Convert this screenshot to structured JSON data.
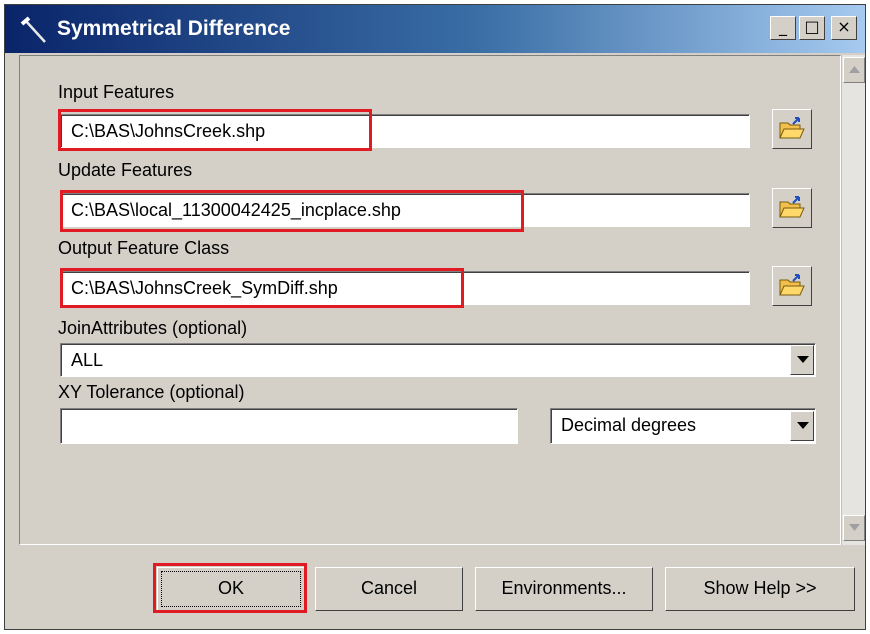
{
  "window": {
    "title": "Symmetrical Difference",
    "minimize_label": "_",
    "maximize_label": "□",
    "close_label": "×"
  },
  "form": {
    "input_features": {
      "label": "Input Features",
      "value": "C:\\BAS\\JohnsCreek.shp"
    },
    "update_features": {
      "label": "Update Features",
      "value": "C:\\BAS\\local_11300042425_incplace.shp"
    },
    "output_feature_class": {
      "label": "Output Feature Class",
      "value": "C:\\BAS\\JohnsCreek_SymDiff.shp"
    },
    "join_attributes": {
      "label": "JoinAttributes (optional)",
      "value": "ALL"
    },
    "xy_tolerance": {
      "label": "XY Tolerance (optional)",
      "value": "",
      "unit": "Decimal degrees"
    }
  },
  "buttons": {
    "ok": "OK",
    "cancel": "Cancel",
    "environments": "Environments...",
    "show_help": "Show Help >>"
  },
  "icons": {
    "title": "hammer-icon",
    "browse": "open-folder-icon",
    "dropdown": "chevron-down-icon",
    "scroll_up": "scroll-up-arrow-icon",
    "scroll_down": "scroll-down-arrow-icon"
  },
  "colors": {
    "titlebar_start": "#0a246a",
    "titlebar_end": "#a6caf0",
    "face": "#d4d0c8",
    "highlight_annotation": "#e01b24"
  }
}
